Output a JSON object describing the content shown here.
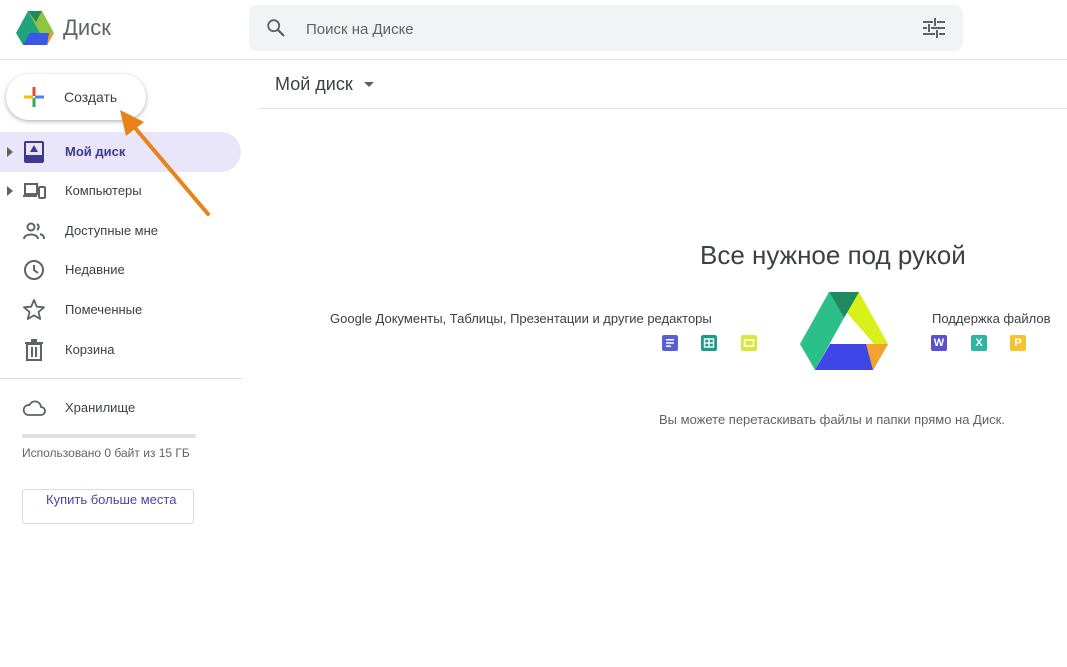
{
  "header": {
    "app_name": "Диск",
    "search_placeholder": "Поиск на Диске"
  },
  "sidebar": {
    "create_label": "Создать",
    "items": [
      {
        "label": "Мой диск",
        "icon": "my-drive-icon",
        "active": true,
        "expandable": true
      },
      {
        "label": "Компьютеры",
        "icon": "computers-icon",
        "active": false,
        "expandable": true
      },
      {
        "label": "Доступные мне",
        "icon": "shared-people-icon",
        "active": false,
        "expandable": false
      },
      {
        "label": "Недавние",
        "icon": "clock-icon",
        "active": false,
        "expandable": false
      },
      {
        "label": "Помеченные",
        "icon": "star-icon",
        "active": false,
        "expandable": false
      },
      {
        "label": "Корзина",
        "icon": "trash-icon",
        "active": false,
        "expandable": false
      }
    ],
    "storage": {
      "label": "Хранилище",
      "icon": "cloud-icon",
      "used_text": "Использовано 0 байт из 15 ГБ",
      "used_fraction": 0,
      "buy_label": "Купить больше места"
    }
  },
  "main": {
    "breadcrumb": "Мой диск",
    "empty_title": "Все нужное под рукой",
    "editors_text": "Google Документы, Таблицы, Презентации и другие редакторы",
    "support_text": "Поддержка файлов",
    "support_letters": [
      "W",
      "X",
      "P"
    ],
    "drag_hint": "Вы можете перетаскивать файлы и папки прямо на Диск."
  },
  "colors": {
    "active_bg": "#e8e6f8",
    "active_text": "#3f3a8f",
    "docs": "#5b5fd6",
    "sheets": "#1a9c8c",
    "slides": "#d7e83a",
    "word": "#5b4fd1",
    "excel": "#2cb5a4",
    "ppt": "#f4c430",
    "annotation_arrow": "#e8821a"
  }
}
